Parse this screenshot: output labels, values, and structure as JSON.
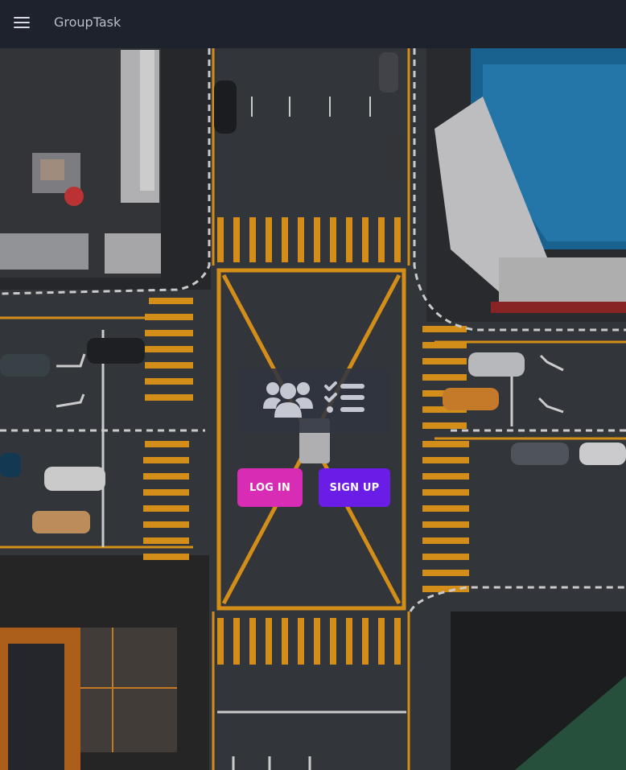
{
  "navbar": {
    "menu_icon": "hamburger-menu-icon",
    "brand": "GroupTask"
  },
  "hero": {
    "logo_icons": [
      "users-icon",
      "checklist-icon"
    ],
    "login_label": "LOG IN",
    "signup_label": "SIGN UP"
  },
  "colors": {
    "navbar_bg": "#1e222c",
    "login_button": "#d82cb4",
    "signup_button": "#6a1de6",
    "road_marking": "#f0a21c"
  }
}
